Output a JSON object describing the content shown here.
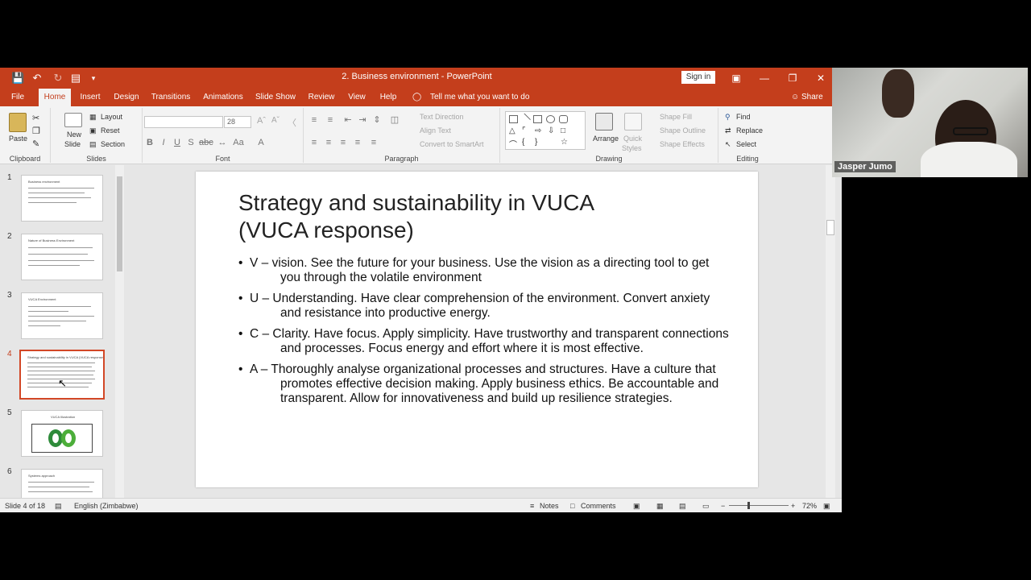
{
  "window": {
    "title": "2. Business environment  -  PowerPoint",
    "sign_in": "Sign in"
  },
  "tabs": [
    "File",
    "Home",
    "Insert",
    "Design",
    "Transitions",
    "Animations",
    "Slide Show",
    "Review",
    "View",
    "Help"
  ],
  "active_tab": "Home",
  "tell_me": "Tell me what you want to do",
  "share": "Share",
  "ribbon": {
    "clipboard": {
      "label": "Clipboard",
      "paste": "Paste"
    },
    "slides": {
      "label": "Slides",
      "new_slide_1": "New",
      "new_slide_2": "Slide",
      "layout": "Layout",
      "reset": "Reset",
      "section": "Section"
    },
    "font": {
      "label": "Font",
      "font_name": "",
      "font_size": "28"
    },
    "paragraph": {
      "label": "Paragraph",
      "text_direction": "Text Direction",
      "align_text": "Align Text",
      "convert_smartart": "Convert to SmartArt"
    },
    "drawing": {
      "label": "Drawing",
      "arrange": "Arrange",
      "quick_styles_1": "Quick",
      "quick_styles_2": "Styles",
      "shape_fill": "Shape Fill",
      "shape_outline": "Shape Outline",
      "shape_effects": "Shape Effects"
    },
    "editing": {
      "label": "Editing",
      "find": "Find",
      "replace": "Replace",
      "select": "Select"
    }
  },
  "thumbnails": [
    {
      "num": "1",
      "title": "Business environment"
    },
    {
      "num": "2",
      "title": "Nature of Business Environment"
    },
    {
      "num": "3",
      "title": "VUCA Environment"
    },
    {
      "num": "4",
      "title": "Strategy and sustainability in VUCA (VUCA response)"
    },
    {
      "num": "5",
      "title": "VUCA Illustration"
    },
    {
      "num": "6",
      "title": "Systems approach"
    }
  ],
  "active_slide": "4",
  "slide": {
    "title_line1": "Strategy and sustainability in VUCA",
    "title_line2": "(VUCA response)",
    "bullets": [
      "V – vision. See the future for your business. Use the vision as a        directing tool to get you through the volatile environment",
      "U – Understanding. Have clear comprehension of the environment. Convert anxiety and resistance into productive energy.",
      "C – Clarity. Have focus. Apply simplicity. Have trustworthy and transparent connections and processes. Focus energy and effort where it is most effective.",
      "A – Thoroughly analyse organizational processes and structures. Have a culture that promotes effective decision making. Apply business ethics. Be accountable and transparent. Allow for innovativeness and build up resilience strategies."
    ]
  },
  "status": {
    "slide_of": "Slide 4 of 18",
    "language": "English (Zimbabwe)",
    "notes": "Notes",
    "comments": "Comments",
    "zoom": "72%"
  },
  "webcam": {
    "name": "Jasper Jumo"
  },
  "colors": {
    "accent": "#c43e1c",
    "active_thumb": "#d24726"
  }
}
